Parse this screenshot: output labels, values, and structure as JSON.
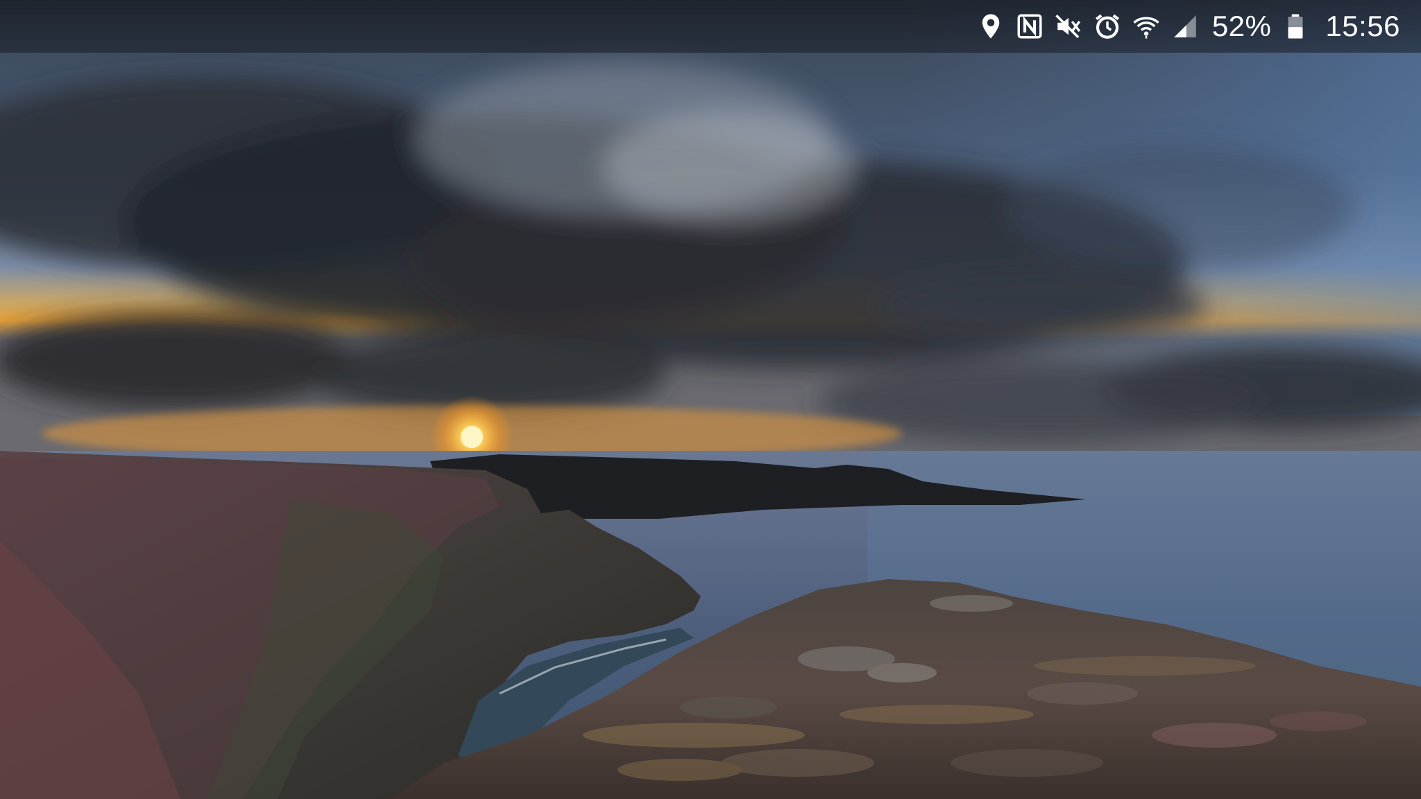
{
  "status_bar": {
    "icons": [
      "location-icon",
      "nfc-icon",
      "mute-icon",
      "alarm-icon",
      "wifi-icon",
      "signal-icon",
      "battery-icon"
    ],
    "battery_percent": "52%",
    "battery_level": 0.52,
    "time": "15:56",
    "icon_color": "#ffffff"
  },
  "wallpaper": {
    "description_colors": {
      "sky_top": "#2a3446",
      "sky_blue": "#5f7fa6",
      "sun": "#ffd15a",
      "horizon_glow": "#f2a23a",
      "sea": "#4e5f7d",
      "cliff": "#4b3a3c"
    }
  }
}
